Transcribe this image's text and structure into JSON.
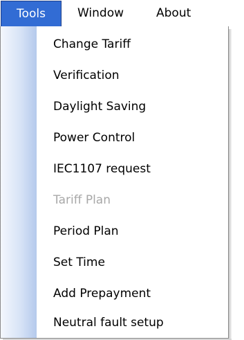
{
  "menubar": {
    "items": [
      {
        "label": "Tools",
        "active": true
      },
      {
        "label": "Window",
        "active": false
      },
      {
        "label": "About",
        "active": false
      }
    ]
  },
  "dropdown": {
    "items": [
      {
        "label": "Change Tariff",
        "enabled": true
      },
      {
        "label": "Verification",
        "enabled": true
      },
      {
        "label": "Daylight Saving",
        "enabled": true
      },
      {
        "label": "Power Control",
        "enabled": true
      },
      {
        "label": "IEC1107 request",
        "enabled": true
      },
      {
        "label": "Tariff Plan",
        "enabled": false
      },
      {
        "label": "Period Plan",
        "enabled": true
      },
      {
        "label": "Set Time",
        "enabled": true
      },
      {
        "label": "Add Prepayment",
        "enabled": true
      },
      {
        "label": "Neutral fault setup",
        "enabled": true
      }
    ]
  },
  "colors": {
    "active_menu_bg": "#326cd4",
    "active_menu_text": "#ffffff",
    "disabled_text": "#a8a8a8",
    "gutter_gradient_end": "#b4c9ec"
  }
}
